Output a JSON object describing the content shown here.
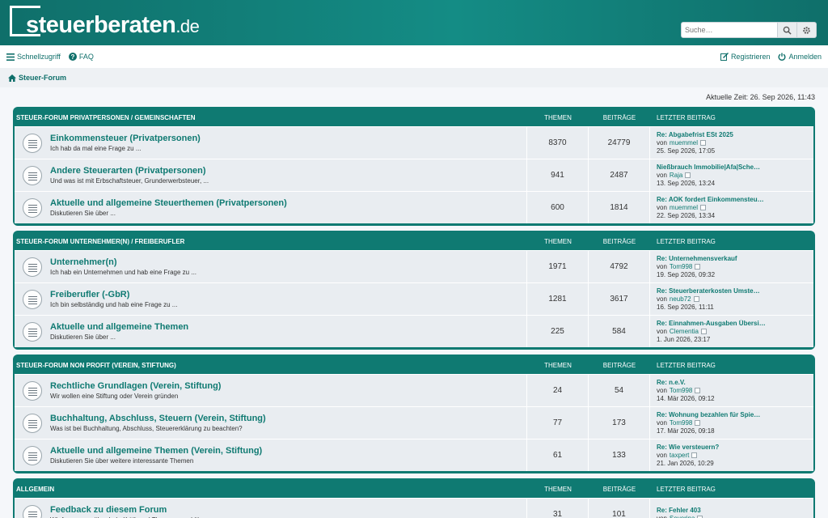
{
  "header": {
    "logo_main": "steuerberaten",
    "logo_tld": ".de",
    "search_placeholder": "Suche…"
  },
  "nav": {
    "quicklinks": "Schnellzugriff",
    "faq": "FAQ",
    "register": "Registrieren",
    "login": "Anmelden"
  },
  "breadcrumb": {
    "label": "Steuer-Forum"
  },
  "current_time": "Aktuelle Zeit: 26. Sep 2026, 11:43",
  "columns": {
    "topics": "Themen",
    "posts": "Beiträge",
    "last": "Letzter Beitrag"
  },
  "by_prefix": "von",
  "categories": [
    {
      "title": "Steuer-Forum Privatpersonen / Gemeinschaften",
      "forums": [
        {
          "title": "Einkommensteuer (Privatpersonen)",
          "desc": "Ich hab da mal eine Frage zu ...",
          "topics": "8370",
          "posts": "24779",
          "last_title": "Re: Abgabefrist ESt 2025",
          "last_user": "muemmel",
          "last_time": "25. Sep 2026, 17:05"
        },
        {
          "title": "Andere Steuerarten (Privatpersonen)",
          "desc": "Und was ist mit Erbschaftsteuer, Grunderwerbsteuer, ...",
          "topics": "941",
          "posts": "2487",
          "last_title": "Nießbrauch Immobilie|Afa|Sche…",
          "last_user": "Raja",
          "last_time": "13. Sep 2026, 13:24"
        },
        {
          "title": "Aktuelle und allgemeine Steuerthemen (Privatpersonen)",
          "desc": "Diskutieren Sie über ...",
          "topics": "600",
          "posts": "1814",
          "last_title": "Re: AOK fordert Einkommensteu…",
          "last_user": "muemmel",
          "last_time": "22. Sep 2026, 13:34"
        }
      ]
    },
    {
      "title": "Steuer-Forum Unternehmer(n) / Freiberufler",
      "forums": [
        {
          "title": "Unternehmer(n)",
          "desc": "Ich hab ein Unternehmen und hab eine Frage zu ...",
          "topics": "1971",
          "posts": "4792",
          "last_title": "Re: Unternehmensverkauf",
          "last_user": "Tom998",
          "last_time": "19. Sep 2026, 09:32"
        },
        {
          "title": "Freiberufler (-GbR)",
          "desc": "Ich bin selbständig und hab eine Frage zu ...",
          "topics": "1281",
          "posts": "3617",
          "last_title": "Re: Steuerberaterkosten Umste…",
          "last_user": "neub72",
          "last_time": "16. Sep 2026, 11:11"
        },
        {
          "title": "Aktuelle und allgemeine Themen",
          "desc": "Diskutieren Sie über ...",
          "topics": "225",
          "posts": "584",
          "last_title": "Re: Einnahmen-Ausgaben Übersi…",
          "last_user": "Clementia",
          "last_time": "1. Jun 2026, 23:17"
        }
      ]
    },
    {
      "title": "Steuer-Forum Non Profit (Verein, Stiftung)",
      "forums": [
        {
          "title": "Rechtliche Grundlagen (Verein, Stiftung)",
          "desc": "Wir wollen eine Stiftung oder Verein gründen",
          "topics": "24",
          "posts": "54",
          "last_title": "Re: n.e.V.",
          "last_user": "Tom998",
          "last_time": "14. Mär 2026, 09:12"
        },
        {
          "title": "Buchhaltung, Abschluss, Steuern (Verein, Stiftung)",
          "desc": "Was ist bei Buchhaltung, Abschluss, Steuererklärung zu beachten?",
          "topics": "77",
          "posts": "173",
          "last_title": "Re: Wohnung bezahlen für Spie…",
          "last_user": "Tom998",
          "last_time": "17. Mär 2026, 09:18"
        },
        {
          "title": "Aktuelle und allgemeine Themen (Verein, Stiftung)",
          "desc": "Diskutieren Sie über weitere interessante Themen",
          "topics": "61",
          "posts": "133",
          "last_title": "Re: Wie versteuern?",
          "last_user": "taxpert",
          "last_time": "21. Jan 2026, 10:29"
        }
      ]
    },
    {
      "title": "Allgemein",
      "forums": [
        {
          "title": "Feedback zu diesem Forum",
          "desc": "Wir freuen uns über Lob, Kritik und Themenvorschläge",
          "topics": "31",
          "posts": "101",
          "last_title": "Re: Fehler 403",
          "last_user": "Severina",
          "last_time": ""
        }
      ]
    }
  ],
  "colors": {
    "brand": "#0f7a72",
    "header": "#148c85",
    "row_bg": "#e9edf1"
  },
  "icons": [
    "menu-icon",
    "help-icon",
    "home-icon",
    "search-icon",
    "gear-icon",
    "edit-icon",
    "power-icon",
    "forum-read-icon",
    "view-latest-icon"
  ]
}
